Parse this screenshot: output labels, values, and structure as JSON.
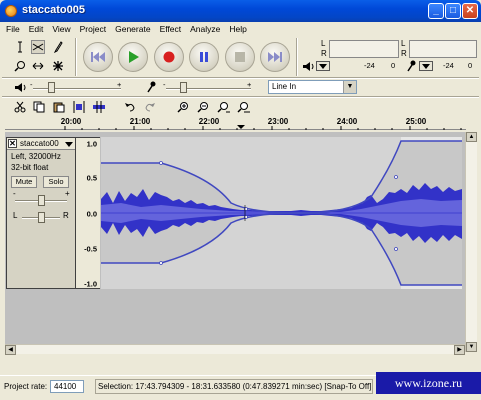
{
  "window": {
    "title": "staccato005",
    "minimize": "_",
    "maximize": "□",
    "close": "✕"
  },
  "menu": [
    "File",
    "Edit",
    "View",
    "Project",
    "Generate",
    "Effect",
    "Analyze",
    "Help"
  ],
  "tools": [
    "selection-tool",
    "envelope-tool",
    "draw-tool",
    "zoom-tool",
    "timeshift-tool",
    "multi-tool"
  ],
  "transport": [
    "skip-start",
    "play",
    "record",
    "pause",
    "stop",
    "skip-end"
  ],
  "meters": {
    "lr_left": [
      "L",
      "R"
    ],
    "lr_right": [
      "L",
      "R"
    ],
    "value_left": "-24",
    "zero_left": "0",
    "value_right": "-24",
    "zero_right": "0"
  },
  "mixer": {
    "minus": "-",
    "plus": "+",
    "input_source": "Line In",
    "output_level": 0.2,
    "input_level": 0.2
  },
  "ruler": {
    "ticks": [
      "20:00",
      "21:00",
      "22:00",
      "23:00",
      "24:00",
      "25:00"
    ]
  },
  "track": {
    "name": "staccato00",
    "channel": "Left, 32000Hz",
    "format": "32-bit float",
    "mute": "Mute",
    "solo": "Solo",
    "gain_minus": "-",
    "gain_plus": "+",
    "pan_left": "L",
    "pan_right": "R",
    "gain_level": 0.5,
    "pan_level": 0.5,
    "scale": [
      "1.0",
      "0.5",
      "0.0",
      "-0.5",
      "-1.0"
    ]
  },
  "colors": {
    "waveform": "#3232c8",
    "waveform_light": "#6464dc",
    "track_bg": "#bfbfbf",
    "title_blue": "#0048d8"
  },
  "status": {
    "rate_label": "Project rate:",
    "rate_value": "44100",
    "selection": "Selection: 17:43.794309 - 18:31.633580 (0:47.839271 min:sec)",
    "snap": "[Snap-To Off]"
  },
  "watermark": "www.izone.ru"
}
